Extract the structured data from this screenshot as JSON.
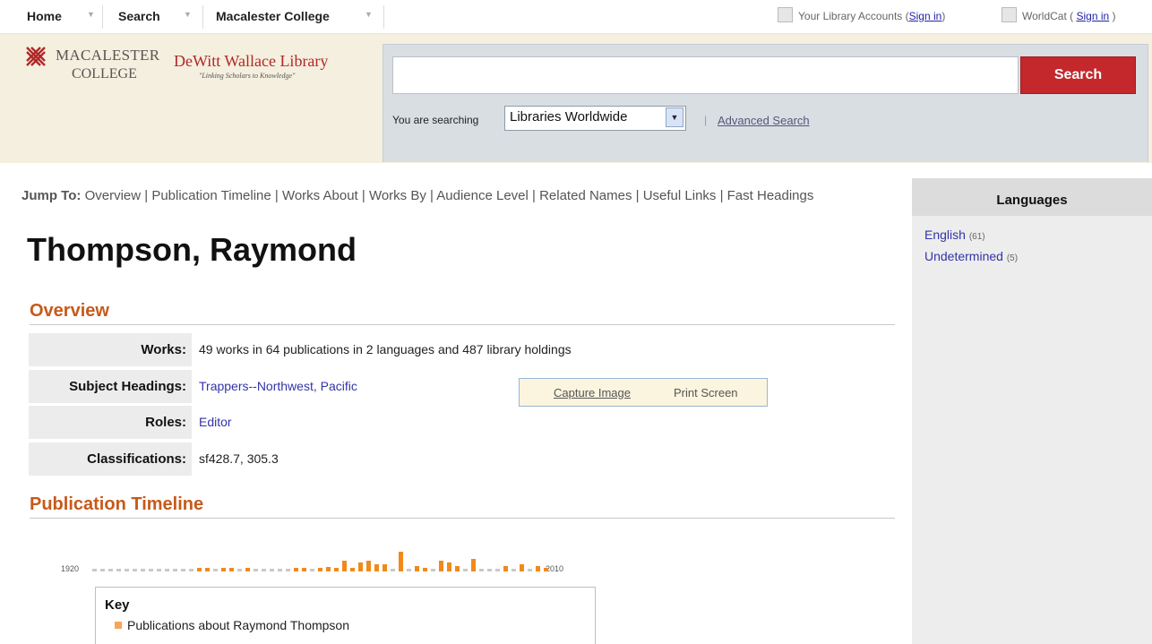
{
  "topnav": {
    "items": [
      "Home",
      "Search",
      "Macalester College"
    ],
    "accounts_label": "Your Library Accounts",
    "accounts_signin": "Sign in",
    "worldcat_label": "WorldCat",
    "worldcat_signin": "Sign in"
  },
  "brand": {
    "college_line1": "MACALESTER",
    "college_line2": "COLLEGE",
    "library_name": "DeWitt Wallace Library",
    "tagline": "\"Linking Scholars to Knowledge\"",
    "logo_color": "#b02828"
  },
  "search": {
    "query": "",
    "button_label": "Search",
    "searching_label": "You are searching",
    "scope_selected": "Libraries Worldwide",
    "advanced_link": "Advanced Search",
    "button_color": "#c4282c"
  },
  "jump": {
    "label": "Jump To:",
    "links": [
      "Overview",
      "Publication Timeline",
      "Works About",
      "Works By",
      "Audience Level",
      "Related Names",
      "Useful Links",
      "Fast Headings"
    ]
  },
  "page_title": "Thompson, Raymond",
  "overview": {
    "heading": "Overview",
    "rows": [
      {
        "label": "Works:",
        "value": "49 works in 64 publications in 2 languages and 487 library holdings"
      },
      {
        "label": "Subject Headings:",
        "value": "Trappers--Northwest, Pacific"
      },
      {
        "label": "Roles:",
        "value": "Editor"
      },
      {
        "label": "Classifications:",
        "value": "sf428.7, 305.3"
      }
    ],
    "capture_image": "Capture Image",
    "print_screen": "Print Screen"
  },
  "timeline": {
    "heading": "Publication Timeline",
    "start_year": "1920",
    "end_year": "2010",
    "accent_color": "#f08a1c",
    "empty_color": "#c9c9c9"
  },
  "key": {
    "title": "Key",
    "items": [
      "Publications about Raymond Thompson"
    ]
  },
  "languages": {
    "heading": "Languages",
    "items": [
      {
        "name": "English",
        "count": "(61)"
      },
      {
        "name": "Undetermined",
        "count": "(5)"
      }
    ]
  }
}
